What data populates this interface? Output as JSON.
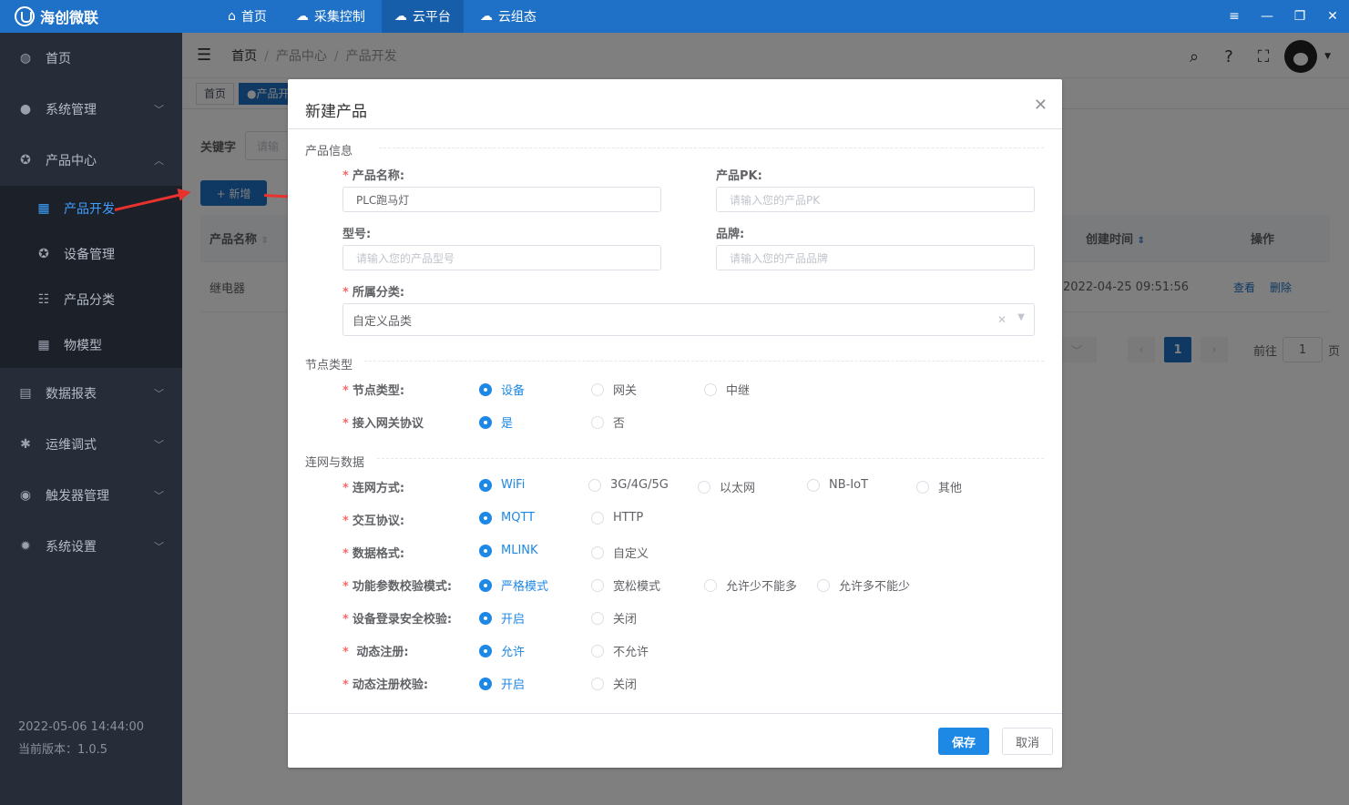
{
  "app": {
    "title": "海创微联"
  },
  "topnav": [
    {
      "label": "首页",
      "icon": "home-icon"
    },
    {
      "label": "采集控制",
      "icon": "cloud-gear-icon"
    },
    {
      "label": "云平台",
      "icon": "cloud-platform-icon"
    },
    {
      "label": "云组态",
      "icon": "cloud-config-icon"
    }
  ],
  "sidebar": {
    "items": [
      {
        "label": "首页",
        "icon": "dashboard-icon"
      },
      {
        "label": "系统管理",
        "icon": "user-icon"
      },
      {
        "label": "产品中心",
        "icon": "product-icon"
      },
      {
        "label": "数据报表",
        "icon": "report-icon"
      },
      {
        "label": "运维调式",
        "icon": "bug-icon"
      },
      {
        "label": "触发器管理",
        "icon": "trigger-icon"
      },
      {
        "label": "系统设置",
        "icon": "gear-icon"
      }
    ],
    "sub": [
      {
        "label": "产品开发",
        "icon": "calendar-icon"
      },
      {
        "label": "设备管理",
        "icon": "device-icon"
      },
      {
        "label": "产品分类",
        "icon": "category-icon"
      },
      {
        "label": "物模型",
        "icon": "grid-icon"
      }
    ],
    "datetime": "2022-05-06 14:44:00",
    "version": "当前版本：1.0.5"
  },
  "breadcrumb": [
    "首页",
    "产品中心",
    "产品开发"
  ],
  "tags": [
    "首页",
    "产品开"
  ],
  "filter": {
    "label": "关键字",
    "placeholder": "请输"
  },
  "add_button": "+ 新增",
  "table": {
    "headers": {
      "name": "产品名称",
      "created": "创建时间",
      "ops": "操作"
    },
    "row": {
      "name": "继电器",
      "created": "2022-04-25 09:51:56",
      "view": "查看",
      "delete": "删除"
    }
  },
  "pager": {
    "current": "1",
    "goto_label": "前往",
    "goto_value": "1",
    "page_unit": "页"
  },
  "dialog": {
    "title": "新建产品",
    "sections": {
      "info": "产品信息",
      "node": "节点类型",
      "net": "连网与数据"
    },
    "fields": {
      "name_label": "产品名称:",
      "name_value": "PLC跑马灯",
      "pk_label": "产品PK:",
      "pk_placeholder": "请输入您的产品PK",
      "model_label": "型号:",
      "model_placeholder": "请输入您的产品型号",
      "brand_label": "品牌:",
      "brand_placeholder": "请输入您的产品品牌",
      "category_label": "所属分类:",
      "category_value": "自定义品类"
    },
    "radios": [
      {
        "label": "节点类型:",
        "options": [
          "设备",
          "网关",
          "中继"
        ]
      },
      {
        "label": "接入网关协议",
        "options": [
          "是",
          "否"
        ]
      },
      {
        "label": "连网方式:",
        "options": [
          "WiFi",
          "3G/4G/5G",
          "以太网",
          "NB-IoT",
          "其他"
        ]
      },
      {
        "label": "交互协议:",
        "options": [
          "MQTT",
          "HTTP"
        ]
      },
      {
        "label": "数据格式:",
        "options": [
          "MLINK",
          "自定义"
        ]
      },
      {
        "label": "功能参数校验模式:",
        "options": [
          "严格模式",
          "宽松模式",
          "允许少不能多",
          "允许多不能少"
        ]
      },
      {
        "label": "设备登录安全校验:",
        "options": [
          "开启",
          "关闭"
        ]
      },
      {
        "label": "动态注册:",
        "options": [
          "允许",
          "不允许"
        ]
      },
      {
        "label": "动态注册校验:",
        "options": [
          "开启",
          "关闭"
        ]
      }
    ],
    "save": "保存",
    "cancel": "取消"
  },
  "colors": {
    "primary": "#1e71c6",
    "sidebar": "#262c38",
    "required": "#f56c6c",
    "arrow": "#e8322e"
  }
}
